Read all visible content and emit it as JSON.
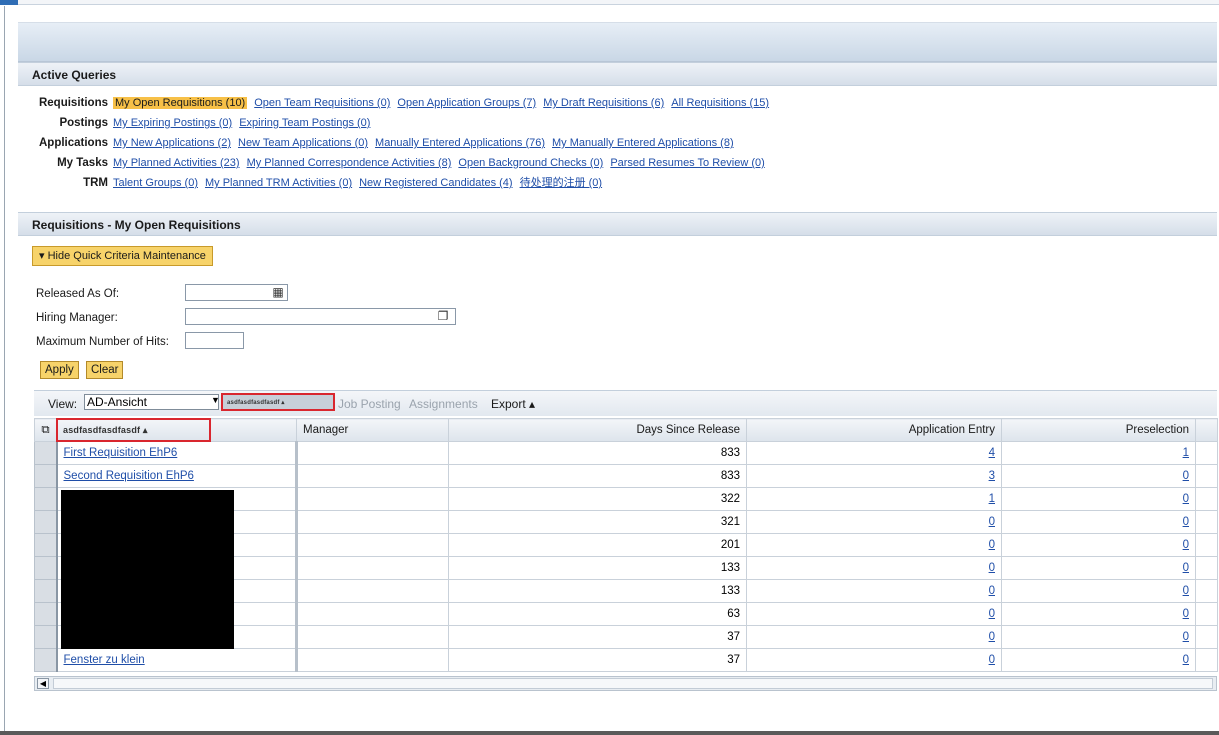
{
  "sections": {
    "active_queries_title": "Active Queries",
    "requisitions_title": "Requisitions - My Open Requisitions"
  },
  "queries": [
    {
      "label": "Requisitions",
      "links": [
        {
          "text": "My Open Requisitions (10)",
          "active": true
        },
        {
          "text": "Open Team Requisitions (0)"
        },
        {
          "text": "Open Application Groups (7)"
        },
        {
          "text": "My Draft Requisitions (6)"
        },
        {
          "text": "All Requisitions (15)"
        }
      ]
    },
    {
      "label": "Postings",
      "links": [
        {
          "text": "My Expiring Postings (0)"
        },
        {
          "text": "Expiring Team Postings (0)"
        }
      ]
    },
    {
      "label": "Applications",
      "links": [
        {
          "text": "My New Applications (2)"
        },
        {
          "text": "New Team Applications (0)"
        },
        {
          "text": "Manually Entered Applications (76)"
        },
        {
          "text": "My Manually Entered Applications (8)"
        }
      ]
    },
    {
      "label": "My Tasks",
      "links": [
        {
          "text": "My Planned Activities (23)"
        },
        {
          "text": "My Planned Correspondence Activities (8)"
        },
        {
          "text": "Open Background Checks (0)"
        },
        {
          "text": "Parsed Resumes To Review (0)"
        }
      ]
    },
    {
      "label": "TRM",
      "links": [
        {
          "text": "Talent Groups (0)"
        },
        {
          "text": "My Planned TRM Activities (0)"
        },
        {
          "text": "New Registered Candidates (4)"
        },
        {
          "text": "待处理的注册 (0)"
        }
      ]
    }
  ],
  "criteria": {
    "toggle_label": "▾ Hide Quick Criteria Maintenance",
    "released_label": "Released As Of:",
    "released_value": "",
    "hiring_label": "Hiring Manager:",
    "hiring_value": "",
    "maxhits_label": "Maximum Number of Hits:",
    "maxhits_value": "",
    "apply_label": "Apply",
    "clear_label": "Clear"
  },
  "toolbar": {
    "view_label": "View:",
    "view_value": "AD-Ansicht",
    "highlight_label": "asdfasdfasdfasdf ▴",
    "job_posting": "Job Posting",
    "assignments": "Assignments",
    "export": "Export ▴"
  },
  "table": {
    "headers": {
      "col1": "asdfasdfasdfasdf ▴",
      "manager": "Manager",
      "days": "Days Since Release",
      "app_entry": "Application Entry",
      "preselection": "Preselection"
    },
    "rows": [
      {
        "name": "First Requisition EhP6",
        "manager": "",
        "days": "833",
        "app_entry": "4",
        "preselection": "1"
      },
      {
        "name": "Second Requisition EhP6",
        "manager": "",
        "days": "833",
        "app_entry": "3",
        "preselection": "0"
      },
      {
        "name": "",
        "manager": "",
        "days": "322",
        "app_entry": "1",
        "preselection": "0"
      },
      {
        "name": "",
        "manager": "",
        "days": "321",
        "app_entry": "0",
        "preselection": "0"
      },
      {
        "name": "",
        "manager": "",
        "days": "201",
        "app_entry": "0",
        "preselection": "0"
      },
      {
        "name": "",
        "manager": "",
        "days": "133",
        "app_entry": "0",
        "preselection": "0"
      },
      {
        "name": "",
        "manager": "",
        "days": "133",
        "app_entry": "0",
        "preselection": "0"
      },
      {
        "name": "",
        "manager": "",
        "days": "63",
        "app_entry": "0",
        "preselection": "0"
      },
      {
        "name": "",
        "manager": "",
        "days": "37",
        "app_entry": "0",
        "preselection": "0"
      },
      {
        "name": "Fenster zu klein",
        "manager": "",
        "days": "37",
        "app_entry": "0",
        "preselection": "0"
      }
    ]
  },
  "icons": {
    "calendar": "calendar-icon",
    "value_help": "value-help-icon",
    "select_all": "select-all-icon",
    "scroll_left": "scroll-left-icon"
  },
  "colors": {
    "link": "#1f4ea8",
    "active_query_bg": "#f7c047",
    "button_bg": "#f7d36a",
    "highlight_border": "#d9262e"
  }
}
